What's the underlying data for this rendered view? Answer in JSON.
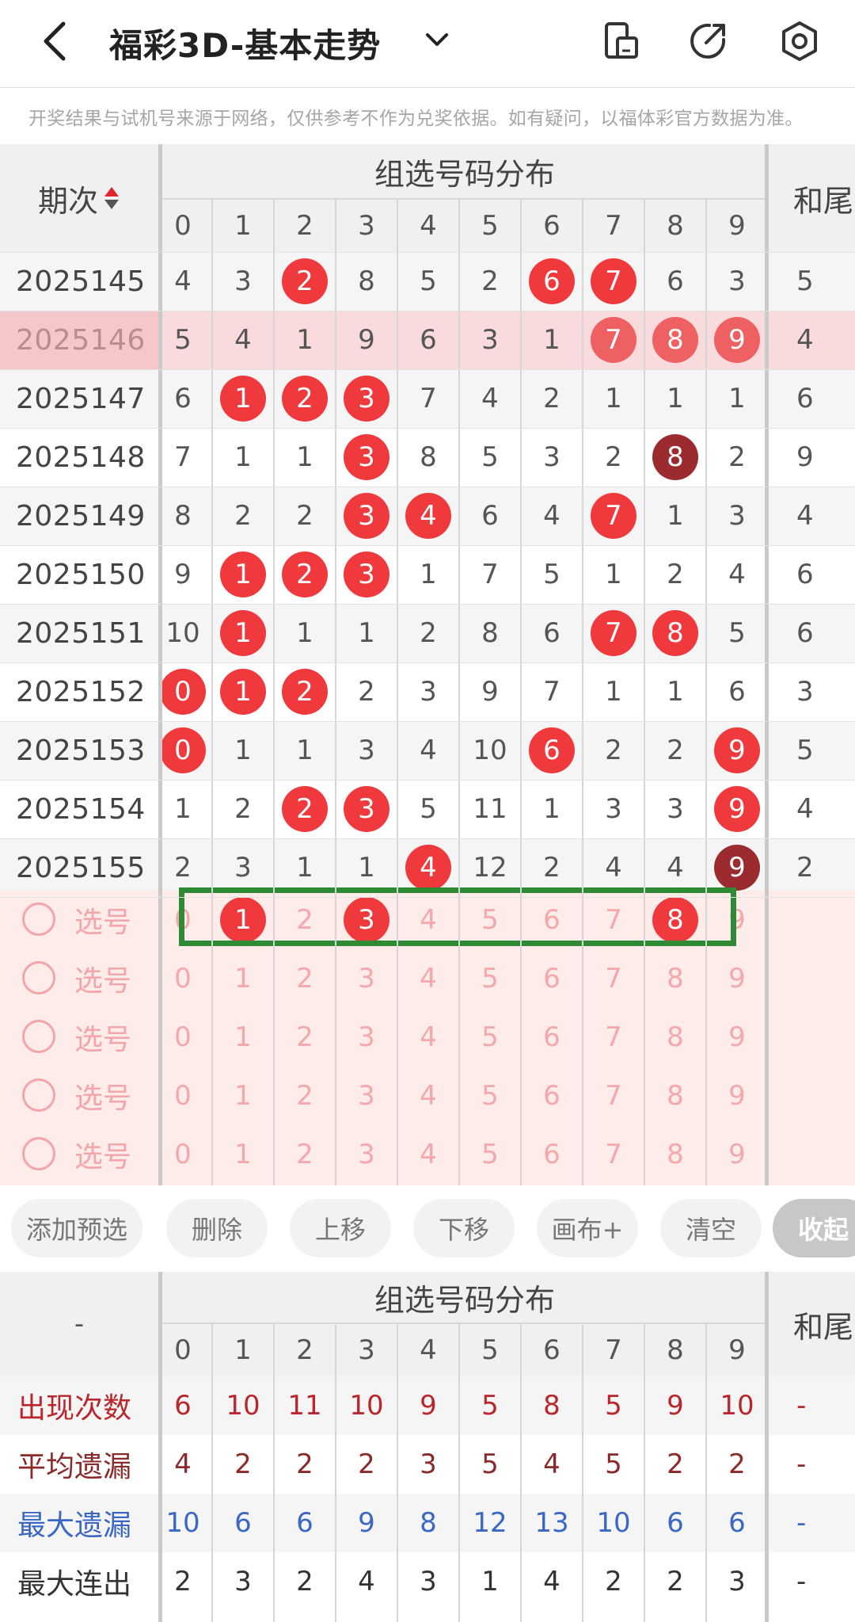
{
  "header": {
    "title": "福彩3D-基本走势",
    "disclaimer": "开奖结果与试机号来源于网络，仅供参考不作为兑奖依据。如有疑问，以福体彩官方数据为准。"
  },
  "table": {
    "period_header": "期次",
    "group_header": "组选号码分布",
    "sum_header": "和尾",
    "digits": [
      "0",
      "1",
      "2",
      "3",
      "4",
      "5",
      "6",
      "7",
      "8",
      "9"
    ],
    "rows": [
      {
        "period": "2025145",
        "cells": [
          "4",
          "3",
          "2",
          "8",
          "5",
          "2",
          "6",
          "7",
          "6",
          "3"
        ],
        "balls": [
          2,
          6,
          7
        ],
        "sum": "5"
      },
      {
        "period": "2025146",
        "cells": [
          "5",
          "4",
          "1",
          "9",
          "6",
          "3",
          "1",
          "7",
          "8",
          "9"
        ],
        "balls": [
          7,
          8,
          9
        ],
        "sum": "4"
      },
      {
        "period": "2025147",
        "cells": [
          "6",
          "1",
          "2",
          "3",
          "7",
          "4",
          "2",
          "1",
          "1",
          "1"
        ],
        "balls": [
          1,
          2,
          3
        ],
        "sum": "6"
      },
      {
        "period": "2025148",
        "cells": [
          "7",
          "1",
          "1",
          "3",
          "8",
          "5",
          "3",
          "2",
          "8",
          "2"
        ],
        "balls": [
          3,
          8
        ],
        "sum": "9"
      },
      {
        "period": "2025149",
        "cells": [
          "8",
          "2",
          "2",
          "3",
          "4",
          "6",
          "4",
          "7",
          "1",
          "3"
        ],
        "balls": [
          3,
          4,
          7
        ],
        "sum": "4"
      },
      {
        "period": "2025150",
        "cells": [
          "9",
          "1",
          "2",
          "3",
          "1",
          "7",
          "5",
          "1",
          "2",
          "4"
        ],
        "balls": [
          1,
          2,
          3
        ],
        "sum": "6"
      },
      {
        "period": "2025151",
        "cells": [
          "10",
          "1",
          "1",
          "1",
          "2",
          "8",
          "6",
          "7",
          "8",
          "5"
        ],
        "balls": [
          1,
          7,
          8
        ],
        "sum": "6"
      },
      {
        "period": "2025152",
        "cells": [
          "0",
          "1",
          "2",
          "2",
          "3",
          "9",
          "7",
          "1",
          "1",
          "6"
        ],
        "balls": [
          0,
          1,
          2
        ],
        "sum": "3"
      },
      {
        "period": "2025153",
        "cells": [
          "0",
          "1",
          "1",
          "3",
          "4",
          "10",
          "6",
          "2",
          "2",
          "9"
        ],
        "balls": [
          0,
          6,
          9
        ],
        "sum": "5"
      },
      {
        "period": "2025154",
        "cells": [
          "1",
          "2",
          "2",
          "3",
          "5",
          "11",
          "1",
          "3",
          "3",
          "9"
        ],
        "balls": [
          2,
          3,
          9
        ],
        "sum": "4"
      },
      {
        "period": "2025155",
        "cells": [
          "2",
          "3",
          "1",
          "1",
          "4",
          "12",
          "2",
          "4",
          "4",
          "9"
        ],
        "balls": [
          4,
          9
        ],
        "sum": "2"
      }
    ]
  },
  "pick": {
    "label": "选号",
    "rows": [
      {
        "selected": [
          1,
          3,
          8
        ]
      },
      {
        "selected": []
      },
      {
        "selected": []
      },
      {
        "selected": []
      },
      {
        "selected": []
      }
    ]
  },
  "buttons": {
    "add": "添加预选",
    "delete": "删除",
    "up": "上移",
    "down": "下移",
    "canvas": "画布+",
    "clear": "清空",
    "collapse": "收起"
  },
  "stats": {
    "corner": "-",
    "group_header": "组选号码分布",
    "sum_header": "和尾",
    "rows": [
      {
        "label": "出现次数",
        "values": [
          "6",
          "10",
          "11",
          "10",
          "9",
          "5",
          "8",
          "5",
          "9",
          "10"
        ],
        "sum": "-",
        "color": "#b9262c"
      },
      {
        "label": "平均遗漏",
        "values": [
          "4",
          "2",
          "2",
          "2",
          "3",
          "5",
          "4",
          "5",
          "2",
          "2"
        ],
        "sum": "-",
        "color": "#8b2a2a"
      },
      {
        "label": "最大遗漏",
        "values": [
          "10",
          "6",
          "6",
          "9",
          "8",
          "12",
          "13",
          "10",
          "6",
          "6"
        ],
        "sum": "-",
        "color": "#3b67c4"
      },
      {
        "label": "最大连出",
        "values": [
          "2",
          "3",
          "2",
          "4",
          "3",
          "1",
          "4",
          "2",
          "2",
          "3"
        ],
        "sum": "-",
        "color": "#333333"
      }
    ]
  }
}
